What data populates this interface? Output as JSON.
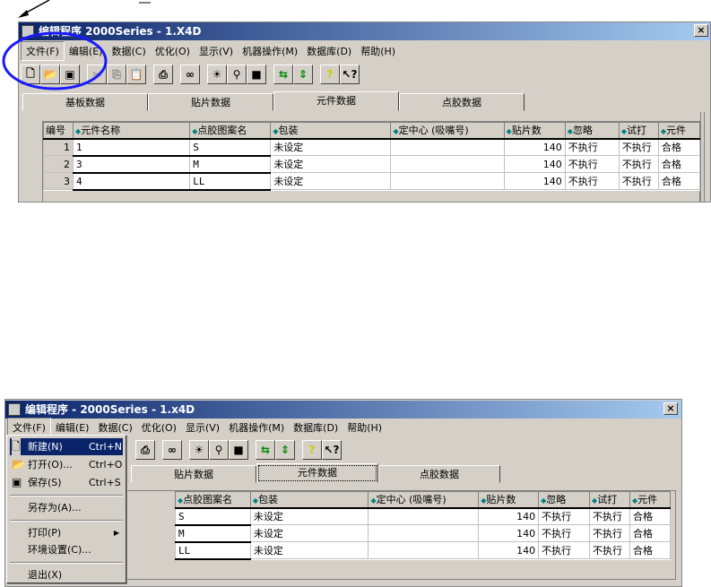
{
  "top_window": {
    "title": "编辑程序  2000Series - 1.X4D",
    "close": "×",
    "menu": [
      "文件(F)",
      "编辑(E)",
      "数据(C)",
      "优化(O)",
      "显示(V)",
      "机器操作(M)",
      "数据库(D)",
      "帮助(H)"
    ],
    "tabs": [
      "基板数据",
      "贴片数据",
      "元件数据",
      "点胶数据"
    ],
    "columns": [
      "编号",
      "元件名称",
      "点胶图案名",
      "包装",
      "定中心 (吸嘴号)",
      "贴片数",
      "忽略",
      "试打",
      "元件"
    ],
    "rows": [
      [
        "1",
        "1",
        "S",
        "未设定",
        "",
        "140",
        "不执行",
        "不执行",
        "合格"
      ],
      [
        "2",
        "3",
        "M",
        "未设定",
        "",
        "140",
        "不执行",
        "不执行",
        "合格"
      ],
      [
        "3",
        "4",
        "LL",
        "未设定",
        "",
        "140",
        "不执行",
        "不执行",
        "合格"
      ]
    ]
  },
  "bottom_window": {
    "title": "编辑程序  - 2000Series - 1.x4D",
    "close": "×",
    "menu": [
      "文件(F)",
      "编辑(E)",
      "数据(C)",
      "优化(O)",
      "显示(V)",
      "机器操作(M)",
      "数据库(D)",
      "帮助(H)"
    ],
    "tabs": [
      "贴片数据",
      "元件数据",
      "点胶数据"
    ],
    "columns": [
      "点胶图案名",
      "包装",
      "定中心 (吸嘴号)",
      "贴片数",
      "忽略",
      "试打",
      "元件"
    ],
    "rows": [
      [
        "S",
        "未设定",
        "",
        "140",
        "不执行",
        "不执行",
        "合格"
      ],
      [
        "M",
        "未设定",
        "",
        "140",
        "不执行",
        "不执行",
        "合格"
      ],
      [
        "LL",
        "未设定",
        "",
        "140",
        "不执行",
        "不执行",
        "合格"
      ]
    ],
    "file_menu": {
      "new": "新建(N)",
      "new_sc": "Ctrl+N",
      "open": "打开(O)...",
      "open_sc": "Ctrl+O",
      "save": "保存(S)",
      "save_sc": "Ctrl+S",
      "save_as": "另存为(A)...",
      "print": "打印(P)",
      "env": "环境设置(C)...",
      "exit": "退出(X)"
    }
  },
  "toolbar_icons": [
    "new-icon",
    "open-icon",
    "save-icon",
    "cut-icon",
    "copy-icon",
    "paste-icon",
    "print-icon",
    "find-icon",
    "light-icon",
    "nozzle-icon",
    "parts-icon",
    "swap-h-icon",
    "swap-v-icon",
    "help-icon",
    "context-help-icon"
  ],
  "colors": {
    "highlight": "#0a246a",
    "annotation": "#1a1aff"
  }
}
